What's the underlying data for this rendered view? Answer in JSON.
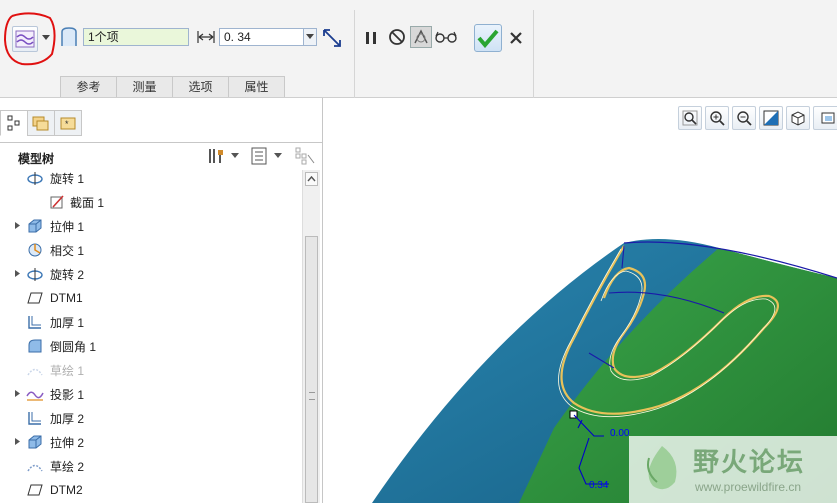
{
  "ribbon": {
    "count_field": "1个项",
    "thickness_value": "0. 34",
    "tabs": [
      "参考",
      "测量",
      "选项",
      "属性"
    ]
  },
  "panel": {
    "tree_title": "模型树"
  },
  "tree": {
    "items": [
      {
        "label": "旋转 1",
        "expandable": false,
        "expanded": true,
        "disabled": false,
        "icon": "revolve-icon"
      },
      {
        "label": "截面 1",
        "expandable": false,
        "expanded": false,
        "disabled": false,
        "icon": "sketch-section-icon"
      },
      {
        "label": "拉伸 1",
        "expandable": true,
        "expanded": false,
        "disabled": false,
        "icon": "extrude-icon"
      },
      {
        "label": "相交 1",
        "expandable": false,
        "expanded": false,
        "disabled": false,
        "icon": "intersect-icon"
      },
      {
        "label": "旋转 2",
        "expandable": true,
        "expanded": false,
        "disabled": false,
        "icon": "revolve-icon"
      },
      {
        "label": "DTM1",
        "expandable": false,
        "expanded": false,
        "disabled": false,
        "icon": "datum-plane-icon"
      },
      {
        "label": "加厚 1",
        "expandable": false,
        "expanded": false,
        "disabled": false,
        "icon": "thicken-icon"
      },
      {
        "label": "倒圆角 1",
        "expandable": false,
        "expanded": false,
        "disabled": false,
        "icon": "round-icon"
      },
      {
        "label": "草绘 1",
        "expandable": false,
        "expanded": false,
        "disabled": true,
        "icon": "sketch-icon"
      },
      {
        "label": "投影 1",
        "expandable": true,
        "expanded": false,
        "disabled": false,
        "icon": "project-icon"
      },
      {
        "label": "加厚 2",
        "expandable": false,
        "expanded": false,
        "disabled": false,
        "icon": "thicken-icon"
      },
      {
        "label": "拉伸 2",
        "expandable": true,
        "expanded": false,
        "disabled": false,
        "icon": "extrude-icon"
      },
      {
        "label": "草绘 2",
        "expandable": false,
        "expanded": false,
        "disabled": false,
        "icon": "sketch-icon"
      },
      {
        "label": "DTM2",
        "expandable": false,
        "expanded": false,
        "disabled": false,
        "icon": "datum-plane-icon"
      }
    ]
  },
  "viewport": {
    "dim_upper": "0.00",
    "dim_lower": "0.34",
    "watermark_title": "野火论坛",
    "watermark_url": "www.proewildfire.cn"
  },
  "colors": {
    "surface_blue": "#1f7aa0",
    "surface_green": "#2e8b3a",
    "accent_check": "#2aa532",
    "annotation_red": "#e01010"
  }
}
